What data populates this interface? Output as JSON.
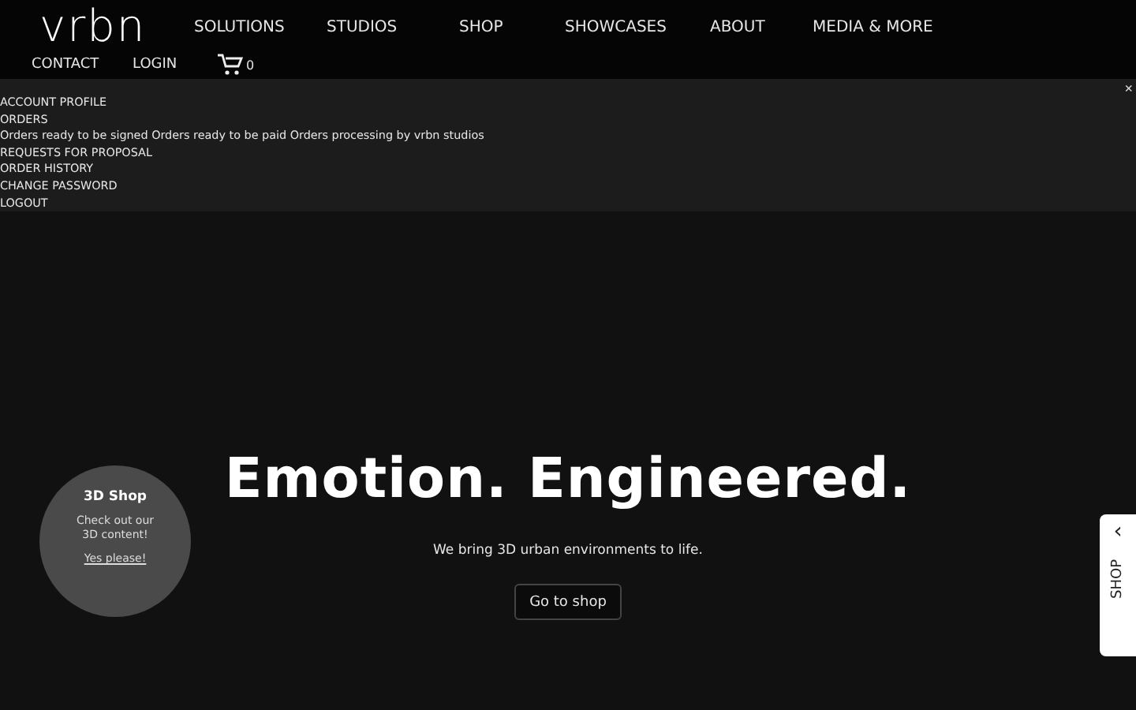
{
  "header": {
    "logo": "vrbn",
    "nav": [
      "SOLUTIONS",
      "STUDIOS",
      "SHOP",
      "SHOWCASES",
      "ABOUT",
      "MEDIA & MORE"
    ],
    "secondary_nav": [
      "CONTACT",
      "LOGIN"
    ],
    "cart_count": "0"
  },
  "account_menu": {
    "close": "×",
    "items": [
      "ACCOUNT PROFILE",
      "ORDERS",
      "Orders ready to be signed Orders ready to be paid Orders processing by vrbn studios",
      "REQUESTS FOR PROPOSAL",
      "ORDER HISTORY",
      "CHANGE PASSWORD",
      "LOGOUT"
    ]
  },
  "hero": {
    "headline": "Emotion. Engineered.",
    "subtitle": "We bring 3D urban environments to life.",
    "button": "Go to shop"
  },
  "shop_bubble": {
    "title": "3D Shop",
    "text": "Check out our 3D content!",
    "link": "Yes please!"
  },
  "side_tab": {
    "arrow": "‹",
    "label": "SHOP"
  }
}
